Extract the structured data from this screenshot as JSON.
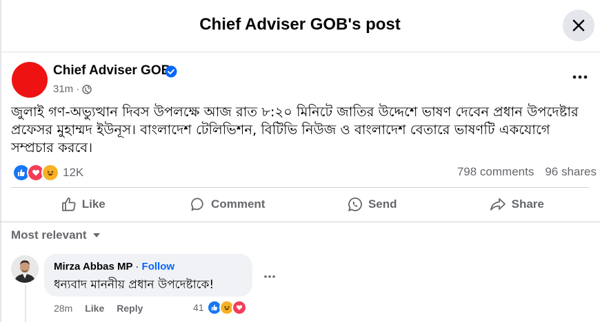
{
  "header": {
    "title": "Chief Adviser GOB's post",
    "close_icon": "close-icon"
  },
  "post": {
    "author": "Chief Adviser GOB",
    "time": "31m",
    "separator": "·",
    "privacy_icon": "globe-icon",
    "more_icon": "more-dots-icon",
    "text": "জুলাই গণ-অভ্যুত্থান দিবস উপলক্ষে আজ রাত ৮:২০ মিনিটে জাতির উদ্দেশে ভাষণ দেবেন প্রধান উপদেষ্টার প্রফেসর মুহাম্মদ ইউনূস। বাংলাদেশ টেলিভিশন, বিটিভি নিউজ ও বাংলাদেশ বেতারে ভাষণটি একযোগে সম্প্রচার করবে।",
    "reactions_count": "12K",
    "comments": "798 comments",
    "shares": "96 shares",
    "colors": {
      "like": "#1877f2",
      "love": "#f33e58",
      "haha": "#f7b125",
      "avatar": "#ee1212"
    }
  },
  "actions": {
    "like": "Like",
    "comment": "Comment",
    "send": "Send",
    "share": "Share"
  },
  "comments_section": {
    "sort_label": "Most relevant",
    "comment": {
      "author": "Mirza Abbas MP",
      "separator": "·",
      "follow": "Follow",
      "text": "ধন্যবাদ মাননীয় প্রধান উপদেষ্টাকে!",
      "time": "28m",
      "like": "Like",
      "reply": "Reply",
      "reaction_count": "41"
    }
  }
}
